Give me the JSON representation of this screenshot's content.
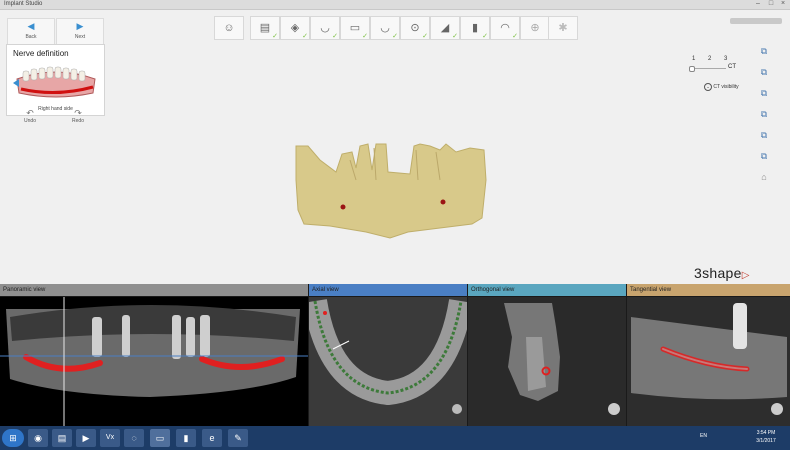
{
  "window": {
    "title": "Implant Studio"
  },
  "nav": {
    "back_label": "Back",
    "next_label": "Next"
  },
  "nerve_panel": {
    "title": "Nerve definition",
    "caption": "Right hand side"
  },
  "history": {
    "undo_label": "Undo",
    "redo_label": "Redo"
  },
  "ct": {
    "ticks": [
      "1",
      "2",
      "3"
    ],
    "slider_label": "CT",
    "visibility_label": "CT visibility"
  },
  "logo": {
    "text": "3shape"
  },
  "views": [
    {
      "label": "Panoramic view",
      "color": "#8f8f8f"
    },
    {
      "label": "Axial view",
      "color": "#4a7fc4"
    },
    {
      "label": "Orthogonal view",
      "color": "#5aa6bf"
    },
    {
      "label": "Tangential view",
      "color": "#c8a46e"
    }
  ],
  "taskbar": {
    "language": "EN",
    "time": "3:54 PM",
    "date": "3/1/2017"
  },
  "colors": {
    "accent": "#3a8fd0",
    "check": "#7cc043",
    "nerve": "#e02020",
    "bone": "#d8c98a"
  }
}
